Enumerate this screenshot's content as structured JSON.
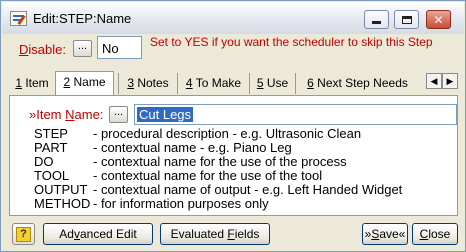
{
  "window": {
    "title": "Edit:STEP:Name",
    "icon": "edit-record-icon"
  },
  "disable": {
    "label_prefix": "",
    "label_underlined": "D",
    "label_rest": "isable:",
    "dots_label": "...",
    "value": "No",
    "help_text": "Set to YES if you want the scheduler to skip this Step"
  },
  "tabs": [
    {
      "num": "1",
      "name": " Item",
      "active": false
    },
    {
      "num": "2",
      "name": " Name",
      "active": true
    },
    {
      "num": "3",
      "name": " Notes",
      "active": false
    },
    {
      "num": "4",
      "name": " To Make",
      "active": false
    },
    {
      "num": "5",
      "name": " Use",
      "active": false
    },
    {
      "num": "6",
      "name": " Next Step Needs",
      "active": false
    }
  ],
  "tab_scroll": {
    "left": "◀",
    "right": "▶"
  },
  "item_name": {
    "label_pre": "»Item ",
    "label_underlined": "N",
    "label_rest": "ame:",
    "dots_label": "...",
    "value": "Cut Legs"
  },
  "definitions": [
    {
      "term": "STEP",
      "desc": "- procedural description - e.g. Ultrasonic Clean"
    },
    {
      "term": "PART",
      "desc": "- contextual name - e.g. Piano Leg"
    },
    {
      "term": "DO",
      "desc": "- contextual name for the use of the process"
    },
    {
      "term": "TOOL",
      "desc": "- contextual name for the use of the tool"
    },
    {
      "term": "OUTPUT",
      "desc": "- contextual name of output - e.g. Left Handed Widget"
    },
    {
      "term": "METHOD",
      "desc": "- for information purposes only"
    }
  ],
  "buttons": {
    "help": "?",
    "advanced_pre": "Ad",
    "advanced_u": "v",
    "advanced_rest": "anced Edit",
    "evaluated_pre": "Evaluated ",
    "evaluated_u": "F",
    "evaluated_rest": "ields",
    "save_pre": "»",
    "save_u": "S",
    "save_rest": "ave«",
    "close_u": "C",
    "close_rest": "lose"
  },
  "colors": {
    "accent_red": "#c00000",
    "selection_blue": "#316ac5",
    "dialog_bg": "#ece9d8"
  }
}
